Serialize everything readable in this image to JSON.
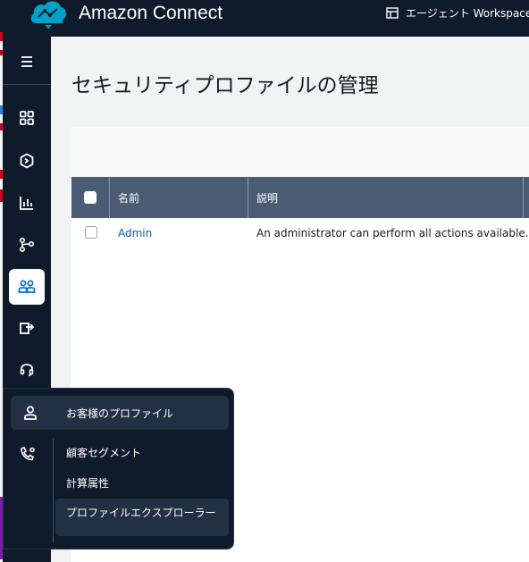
{
  "header": {
    "app_title": "Amazon Connect",
    "workspace_label": "エージェント Workspace"
  },
  "sidebar": {
    "items": [
      {
        "icon": "menu-icon"
      },
      {
        "icon": "dashboard-grid-icon"
      },
      {
        "icon": "routing-hexagon-icon"
      },
      {
        "icon": "analytics-bar-chart-icon"
      },
      {
        "icon": "flows-branch-icon"
      },
      {
        "icon": "users-icon",
        "active": true
      },
      {
        "icon": "channels-export-icon"
      },
      {
        "icon": "headset-icon"
      },
      {
        "icon": "customer-profile-icon"
      },
      {
        "icon": "phone-settings-icon"
      }
    ]
  },
  "page": {
    "title": "セキュリティプロファイルの管理"
  },
  "table": {
    "columns": [
      "名前",
      "説明"
    ],
    "rows": [
      {
        "name": "Admin",
        "description": "An administrator can perform all actions available."
      }
    ]
  },
  "flyout": {
    "header": "お客様のプロファイル",
    "items": [
      {
        "label": "顧客セグメント"
      },
      {
        "label": "計算属性"
      },
      {
        "label": "プロファイルエクスプローラー",
        "highlighted": true
      }
    ]
  },
  "colors": {
    "nav_bg": "#0f1b2a",
    "table_header_bg": "#4a5c73",
    "link": "#0b5c9e",
    "logo": "#00a1c9",
    "accent_active_icon": "#0972d3"
  }
}
